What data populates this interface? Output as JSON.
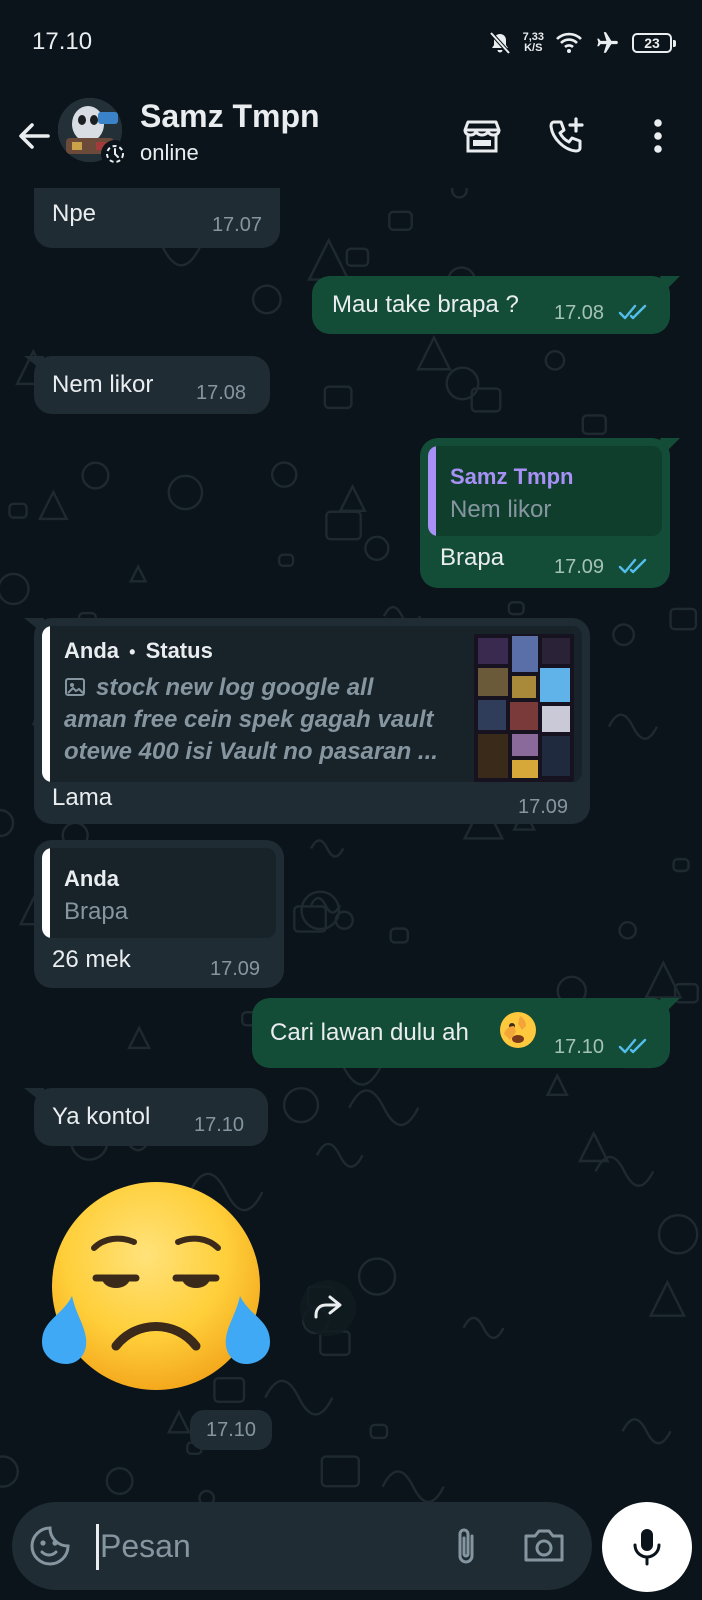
{
  "status_bar": {
    "time": "17.10",
    "net_speed_value": "7,33",
    "net_speed_unit": "K/S",
    "battery": "23"
  },
  "header": {
    "contact_name": "Samz Tmpn",
    "contact_status": "online"
  },
  "messages": [
    {
      "direction": "in",
      "text": "Npe",
      "time": "17.07"
    },
    {
      "direction": "out",
      "text": "Mau take brapa ?",
      "time": "17.08",
      "read": true
    },
    {
      "direction": "in",
      "text": "Nem likor",
      "time": "17.08"
    },
    {
      "direction": "out",
      "quote_author": "Samz Tmpn",
      "quote_text": "Nem likor",
      "text": "Brapa",
      "time": "17.09",
      "read": true
    },
    {
      "direction": "in",
      "quote_author": "Anda",
      "quote_separator": "•",
      "quote_type": "Status",
      "quote_lines": [
        "stock new log google all",
        "aman free cein spek gagah vault",
        "otewe 400 isi Vault no pasaran ..."
      ],
      "text": "Lama",
      "time": "17.09"
    },
    {
      "direction": "in",
      "quote_author": "Anda",
      "quote_text": "Brapa",
      "text": "26 mek",
      "time": "17.09"
    },
    {
      "direction": "out",
      "text": "Cari lawan dulu ah",
      "emoji": "face-with-peeking-eye",
      "time": "17.10",
      "read": true
    },
    {
      "direction": "in",
      "text": "Ya kontol",
      "time": "17.10"
    },
    {
      "direction": "in",
      "sticker": "sad-relieved-crying-face-emoji",
      "time": "17.10"
    }
  ],
  "input": {
    "placeholder": "Pesan"
  },
  "icons": {
    "back": "arrow-left-icon",
    "catalog": "storefront-icon",
    "call": "add-call-icon",
    "menu": "more-vertical-icon",
    "emoji": "sticker-icon",
    "attach": "paperclip-icon",
    "camera": "camera-icon",
    "mic": "mic-icon",
    "forward": "forward-icon"
  },
  "colors": {
    "background": "#0b141a",
    "incoming_bubble": "#1f2c34",
    "outgoing_bubble": "#144d37",
    "read_ticks": "#53bdeb",
    "quote_author_own": "#e9edef",
    "quote_author_contact": "#a791f7",
    "quote_bar_contact": "#a791f7",
    "quote_bar_own": "#ffffff"
  }
}
